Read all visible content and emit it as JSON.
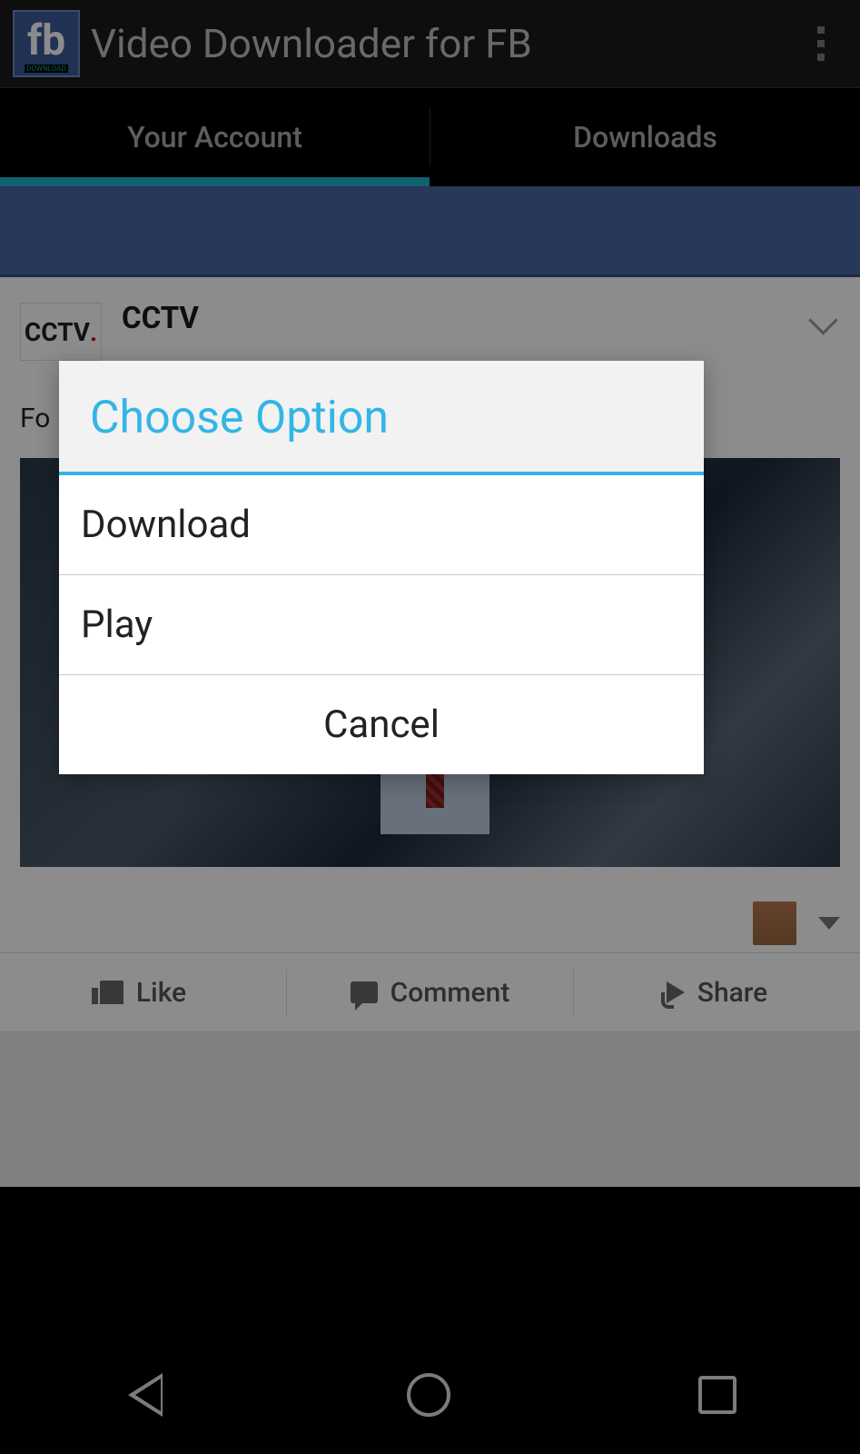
{
  "app": {
    "logo_text": "fb",
    "logo_sub": "DOWNLOAD",
    "title": "Video Downloader for FB"
  },
  "tabs": {
    "account": "Your Account",
    "downloads": "Downloads"
  },
  "post": {
    "author": "CCTV",
    "avatar_text": "CCTV",
    "body_prefix": "Fo",
    "actions": {
      "like": "Like",
      "comment": "Comment",
      "share": "Share"
    }
  },
  "dialog": {
    "title": "Choose Option",
    "download": "Download",
    "play": "Play",
    "cancel": "Cancel"
  }
}
